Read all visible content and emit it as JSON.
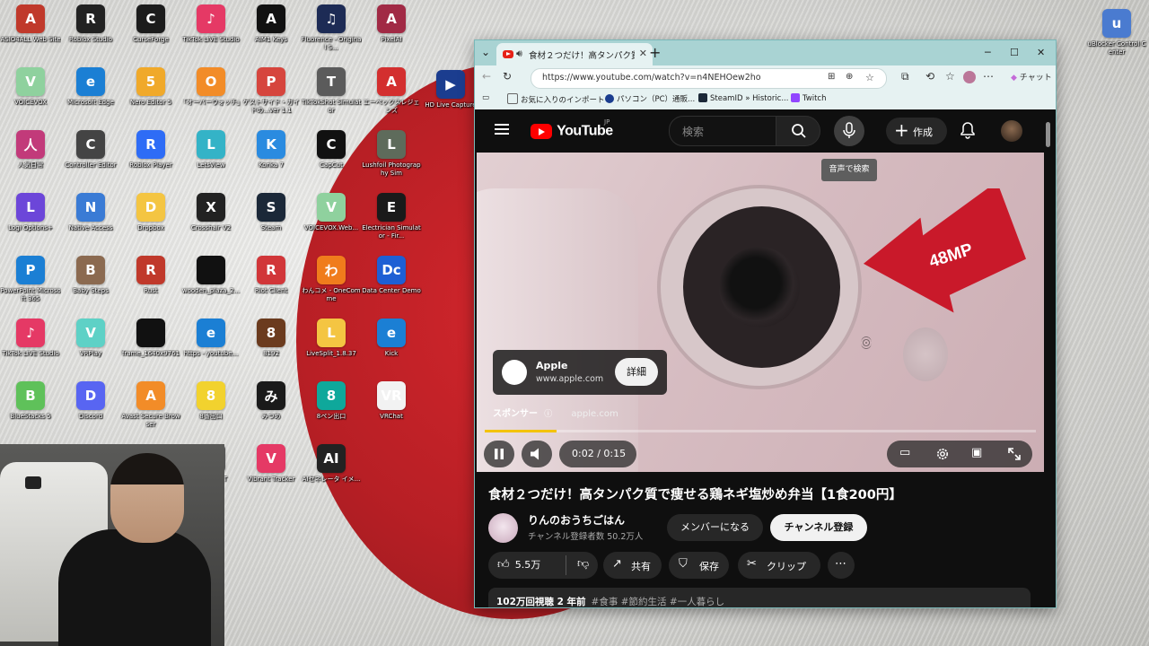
{
  "desktop": {
    "icons": [
      {
        "label": "ASIO4ALL Web Site",
        "color": "#c0392b",
        "glyph": "A"
      },
      {
        "label": "Roblox Studio",
        "color": "#222222",
        "glyph": "R"
      },
      {
        "label": "CurseForge",
        "color": "#1c1c1c",
        "glyph": "C"
      },
      {
        "label": "TikTok LIVE Studio",
        "color": "#e53965",
        "glyph": "♪"
      },
      {
        "label": "AIM1 Keys",
        "color": "#111111",
        "glyph": "A"
      },
      {
        "label": "Fluorence - Original S...",
        "color": "#1d2b55",
        "glyph": "♫"
      },
      {
        "label": "PixelAI",
        "color": "#a12a45",
        "glyph": "A"
      },
      {
        "label": "VOICEVOX",
        "color": "#8fd19e",
        "glyph": "V"
      },
      {
        "label": "Microsoft Edge",
        "color": "#1b7fd4",
        "glyph": "e"
      },
      {
        "label": "Nero Editor 5",
        "color": "#f0a92a",
        "glyph": "5"
      },
      {
        "label": "「オーバーウォッチ」",
        "color": "#f28c28",
        "glyph": "O"
      },
      {
        "label": "ゲストサイド・ガイドの...ver 1.1",
        "color": "#d6453d",
        "glyph": "P"
      },
      {
        "label": "TikTokShot Simulator",
        "color": "#5b5b5b",
        "glyph": "T"
      },
      {
        "label": "エーペックスレジェンズ",
        "color": "#d32f2f",
        "glyph": "A"
      },
      {
        "label": "人気日常",
        "color": "#c23a7a",
        "glyph": "人"
      },
      {
        "label": "Controller Editor",
        "color": "#444444",
        "glyph": "C"
      },
      {
        "label": "Roblox Player",
        "color": "#2e6cf6",
        "glyph": "R"
      },
      {
        "label": "LetsView",
        "color": "#34b3c7",
        "glyph": "L"
      },
      {
        "label": "Konka 7",
        "color": "#2a8be0",
        "glyph": "K"
      },
      {
        "label": "CapCut",
        "color": "#111111",
        "glyph": "C"
      },
      {
        "label": "Lushfoil Photography Sim",
        "color": "#5e6b5b",
        "glyph": "L"
      },
      {
        "label": "Logi Options+",
        "color": "#6c46d9",
        "glyph": "L"
      },
      {
        "label": "Native Access",
        "color": "#3a7bd5",
        "glyph": "N"
      },
      {
        "label": "Dropbox",
        "color": "#f4c542",
        "glyph": "D"
      },
      {
        "label": "Crosshair V2",
        "color": "#222222",
        "glyph": "X"
      },
      {
        "label": "Steam",
        "color": "#1b2838",
        "glyph": "S"
      },
      {
        "label": "VOICEVOX.Web...",
        "color": "#8fd19e",
        "glyph": "V"
      },
      {
        "label": "Electrician Simulator - Fir...",
        "color": "#1a1a1a",
        "glyph": "E"
      },
      {
        "label": "PowerPoint Microsoft 365",
        "color": "#1b7fd4",
        "glyph": "P"
      },
      {
        "label": "Baby Steps",
        "color": "#8b6a50",
        "glyph": "B"
      },
      {
        "label": "Rust",
        "color": "#c0392b",
        "glyph": "R"
      },
      {
        "label": "wooden_plaza_2...",
        "color": "#111111",
        "glyph": ""
      },
      {
        "label": "Riot Client",
        "color": "#d13639",
        "glyph": "R"
      },
      {
        "label": "わんコメ - OneComme",
        "color": "#f07c1c",
        "glyph": "わ"
      },
      {
        "label": "Data Center Demo",
        "color": "#1e5fd4",
        "glyph": "Dc"
      },
      {
        "label": "TikTok LIVE Studio",
        "color": "#e53965",
        "glyph": "♪"
      },
      {
        "label": "VRPlay",
        "color": "#5ed1c6",
        "glyph": "V"
      },
      {
        "label": "frame_1640x9761",
        "color": "#111111",
        "glyph": ""
      },
      {
        "label": "https - youtube...",
        "color": "#1b7fd4",
        "glyph": "e"
      },
      {
        "label": "8192",
        "color": "#6b3b1e",
        "glyph": "8"
      },
      {
        "label": "LiveSplit_1.8.37",
        "color": "#f4c542",
        "glyph": "L"
      },
      {
        "label": "Kick",
        "color": "#1b7fd4",
        "glyph": "e"
      },
      {
        "label": "BlueStacks 5",
        "color": "#5fc15a",
        "glyph": "B"
      },
      {
        "label": "Discord",
        "color": "#5865f2",
        "glyph": "D"
      },
      {
        "label": "Avast Secure Browser",
        "color": "#f28c28",
        "glyph": "A"
      },
      {
        "label": "8番出口",
        "color": "#f2d22e",
        "glyph": "8"
      },
      {
        "label": "みつめ",
        "color": "#1a1a1a",
        "glyph": "み"
      },
      {
        "label": "8ペン出口",
        "color": "#0fa89b",
        "glyph": "8"
      },
      {
        "label": "VRChat",
        "color": "#f2f2f2",
        "glyph": "VR"
      },
      {
        "label": "Epic Games Launcher",
        "color": "#222222",
        "glyph": "E"
      },
      {
        "label": "Iceana",
        "color": "#4a5878",
        "glyph": "I"
      },
      {
        "label": "Product Portal",
        "color": "#3a2d23",
        "glyph": "P"
      },
      {
        "label": "BAE! a PIT",
        "color": "#555555",
        "glyph": "B"
      },
      {
        "label": "Vibrant Tracker",
        "color": "#e53965",
        "glyph": "V"
      },
      {
        "label": "AIゼネレータ イメ...",
        "color": "#222222",
        "glyph": "AI"
      },
      {
        "label": "HD Live Capture",
        "color": "#1b3d8f",
        "glyph": "▶"
      },
      {
        "label": "uBlocker Control Center",
        "color": "#4a7bd0",
        "glyph": "u"
      }
    ]
  },
  "browser": {
    "tab_title": "食材２つだけ！高タンパク質で痩せる鶏ネギ",
    "url": "https://www.youtube.com/watch?v=n4NEHOew2ho",
    "copilot_label": "チャット",
    "favorites": [
      {
        "label": "お気に入りのインポート",
        "color": "#888888"
      },
      {
        "label": "パソコン（PC）通販...",
        "color": "#1b3d8f"
      },
      {
        "label": "SteamID » Historic...",
        "color": "#1b2838"
      },
      {
        "label": "Twitch",
        "color": "#9146ff"
      }
    ]
  },
  "youtube": {
    "logo_text": "YouTube",
    "region": "JP",
    "search_placeholder": "検索",
    "create_label": "作成",
    "mic_tooltip": "音声で検索",
    "ad": {
      "advertiser": "Apple",
      "domain": "www.apple.com",
      "detail_label": "詳細",
      "sponsor_label": "スポンサー",
      "sponsor_domain": "apple.com",
      "overlay_text": "48MP"
    },
    "player": {
      "time": "0:02 / 0:15",
      "progress": 0.13
    },
    "video_title": "食材２つだけ！高タンパク質で痩せる鶏ネギ塩炒め弁当【1食200円】",
    "channel": {
      "name": "りんのおうちごはん",
      "subscribers": "チャンネル登録者数 50.2万人",
      "member_label": "メンバーになる",
      "subscribe_label": "チャンネル登録"
    },
    "actions": {
      "likes": "5.5万",
      "share": "共有",
      "save": "保存",
      "clip": "クリップ"
    },
    "description": {
      "stats": "102万回視聴 2 年前",
      "tags": "#食事 #節約生活 #一人暮らし"
    }
  },
  "colors": {
    "accent_red": "#ff0000",
    "progress": "#f3c300",
    "tab_bar": "#a9d3d3"
  }
}
